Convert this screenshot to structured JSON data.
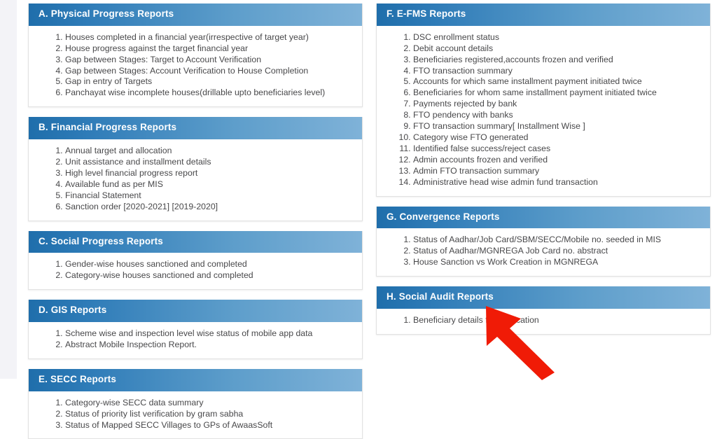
{
  "theme": {
    "header_gradient_from": "#1f6eab",
    "header_gradient_to": "#7fb2d8",
    "header_text_color": "#ffffff",
    "list_text_color": "#48484a",
    "panel_background": "#ffffff",
    "arrow_color": "#f01b06"
  },
  "columns": {
    "left": [
      {
        "id": "physical-progress-reports",
        "title": "A. Physical Progress Reports",
        "items": [
          "Houses completed in a financial year(irrespective of target year)",
          "House progress against the target financial year",
          "Gap between Stages: Target to Account Verification",
          "Gap between Stages: Account Verification to House Completion",
          "Gap in entry of Targets",
          "Panchayat wise incomplete houses(drillable upto beneficiaries level)"
        ]
      },
      {
        "id": "financial-progress-reports",
        "title": "B. Financial Progress Reports",
        "items": [
          "Annual target and allocation",
          "Unit assistance and installment details",
          "High level financial progress report",
          "Available fund as per MIS",
          "Financial Statement",
          "Sanction order [2020-2021] [2019-2020]"
        ]
      },
      {
        "id": "social-progress-reports",
        "title": "C. Social Progress Reports",
        "items": [
          "Gender-wise houses sanctioned and completed",
          "Category-wise houses sanctioned and completed"
        ]
      },
      {
        "id": "gis-reports",
        "title": "D. GIS Reports",
        "items": [
          "Scheme wise and inspection level wise status of mobile app data",
          "Abstract Mobile Inspection Report."
        ]
      },
      {
        "id": "secc-reports",
        "title": "E. SECC Reports",
        "items": [
          "Category-wise SECC data summary",
          "Status of priority list verification by gram sabha",
          "Status of Mapped SECC Villages to GPs of AwaasSoft"
        ]
      }
    ],
    "right": [
      {
        "id": "e-fms-reports",
        "title": "F. E-FMS Reports",
        "items": [
          "DSC enrollment status",
          "Debit account details",
          "Beneficiaries registered,accounts frozen and verified",
          "FTO transaction summary",
          "Accounts for which same installment payment initiated twice",
          "Beneficiaries for whom same installment payment initiated twice",
          "Payments rejected by bank",
          "FTO pendency with banks",
          "FTO transaction summary[ Installment Wise ]",
          "Category wise FTO generated",
          "Identified false success/reject cases",
          "Admin accounts frozen and verified",
          "Admin FTO transaction summary",
          "Administrative head wise admin fund transaction"
        ]
      },
      {
        "id": "convergence-reports",
        "title": "G. Convergence Reports",
        "items": [
          "Status of Aadhar/Job Card/SBM/SECC/Mobile no. seeded in MIS",
          "Status of Aadhar/MGNREGA Job Card no. abstract",
          "House Sanction vs Work Creation in MGNREGA"
        ]
      },
      {
        "id": "social-audit-reports",
        "title": "H. Social Audit Reports",
        "items": [
          "Beneficiary details for verification"
        ]
      }
    ]
  },
  "annotation": {
    "type": "arrow",
    "direction": "up-left",
    "points_to": "Beneficiary details for verification",
    "color": "#f01b06"
  }
}
